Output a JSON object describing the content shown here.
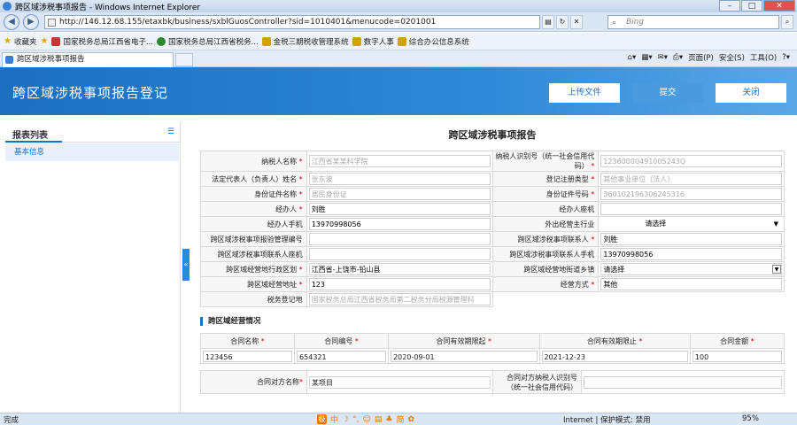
{
  "window": {
    "title": "跨区域涉税事项报告 - Windows Internet Explorer"
  },
  "address": {
    "url": "http://146.12.68.155/etaxbk/business/sxblGuosController?sid=1010401&menucode=0201001",
    "search_placeholder": "Bing"
  },
  "favorites": {
    "label": "收藏夹",
    "items": [
      "国家税务总局江西省电子...",
      "国家税务总局江西省税务...",
      "金税三期税收管理系统",
      "数字人事",
      "综合办公信息系统"
    ]
  },
  "tab": {
    "title": "跨区域涉税事项报告"
  },
  "commandbar": {
    "page": "页面(P)",
    "safety": "安全(S)",
    "tools": "工具(O)"
  },
  "header": {
    "title": "跨区域涉税事项报告登记",
    "upload": "上传文件",
    "submit": "提交",
    "close": "关闭"
  },
  "sidebar": {
    "title": "报表列表",
    "items": [
      "基本信息"
    ]
  },
  "form": {
    "title": "跨区域涉税事项报告",
    "rows": [
      {
        "l1": "纳税人名称",
        "r1": true,
        "v1": "江西省某某科学院",
        "v1ph": true,
        "l2": "纳税人识别号（统一社会信用代码）",
        "r2": true,
        "v2": "12360000491005243Q",
        "v2ph": true
      },
      {
        "l1": "法定代表人（负责人）姓名",
        "r1": true,
        "v1": "张东波",
        "v1ph": true,
        "l2": "登记注册类型",
        "r2": true,
        "v2": "其他事业单位（法人）",
        "v2ph": true
      },
      {
        "l1": "身份证件名称",
        "r1": true,
        "v1": "居民身份证",
        "v1ph": true,
        "l2": "身份证件号码",
        "r2": true,
        "v2": "360102196306245316",
        "v2ph": true
      },
      {
        "l1": "经办人",
        "r1": true,
        "v1": "刘胜",
        "v1ph": false,
        "l2": "经办人座机",
        "r2": false,
        "v2": "",
        "v2ph": false
      },
      {
        "l1": "经办人手机",
        "r1": false,
        "v1": "13970998056",
        "v1ph": false,
        "l2": "外出经营主行业",
        "r2": false,
        "v2": "请选择",
        "v2ph": false,
        "select": true
      },
      {
        "l1": "跨区域涉税事项报验管理编号",
        "r1": false,
        "v1": "",
        "v1ph": false,
        "l2": "跨区域涉税事项联系人",
        "r2": true,
        "v2": "刘胜",
        "v2ph": false
      },
      {
        "l1": "跨区域涉税事项联系人座机",
        "r1": false,
        "v1": "",
        "v1ph": false,
        "l2": "跨区域涉税事项联系人手机",
        "r2": false,
        "v2": "13970998056",
        "v2ph": false
      },
      {
        "l1": "跨区域经营地行政区划",
        "r1": true,
        "v1": "江西省-上饶市-铅山县",
        "v1ph": false,
        "l2": "跨区域经营地街道乡镇",
        "r2": false,
        "v2": "请选择",
        "v2ph": false,
        "select2": true
      },
      {
        "l1": "跨区域经营地址",
        "r1": true,
        "v1": "123",
        "v1ph": false,
        "l2": "经营方式",
        "r2": true,
        "v2": "其他",
        "v2ph": false
      },
      {
        "l1": "税务登记地",
        "r1": false,
        "v1": "国家税务总局江西省税务局第二税务分局税源管理科",
        "v1ph": true,
        "l2": "",
        "r2": false,
        "v2": "",
        "v2ph": false
      }
    ],
    "section": "跨区域经营情况",
    "contract_headers": [
      "合同名称",
      "合同编号",
      "合同有效期限起",
      "合同有效期限止",
      "合同金额"
    ],
    "contract_values": [
      "123456",
      "654321",
      "2020-09-01",
      "2021-12-23",
      "100"
    ],
    "counterparty_name_label": "合同对方名称",
    "counterparty_name": "某项目",
    "counterparty_id_label": "合同对方纳税人识别号（统一社会信用代码）",
    "counterparty_id": ""
  },
  "status": {
    "text": "完成",
    "ime": [
      "中",
      "简"
    ],
    "zone": "Internet | 保护模式: 禁用",
    "zoom": "95%"
  }
}
